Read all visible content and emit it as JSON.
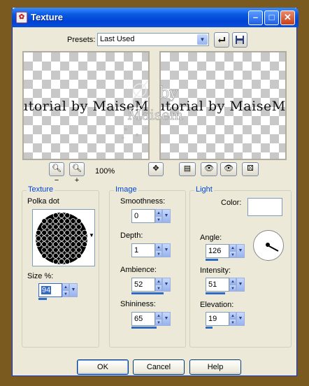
{
  "window": {
    "title": "Texture"
  },
  "presets": {
    "label": "Presets:",
    "value": "Last Used"
  },
  "preview": {
    "left_text": "utorial by MaiseMin",
    "right_text": "utorial by MaiseMin",
    "zoom": "100%"
  },
  "texture": {
    "group_title": "Texture",
    "name": "Polka dot",
    "size_label": "Size %:",
    "size_value": "94"
  },
  "image": {
    "group_title": "Image",
    "smoothness_label": "Smoothness:",
    "smoothness_value": "0",
    "depth_label": "Depth:",
    "depth_value": "1",
    "ambience_label": "Ambience:",
    "ambience_value": "52",
    "shininess_label": "Shininess:",
    "shininess_value": "65"
  },
  "light": {
    "group_title": "Light",
    "color_label": "Color:",
    "color_value": "#ffffff",
    "angle_label": "Angle:",
    "angle_value": "126",
    "intensity_label": "Intensity:",
    "intensity_value": "51",
    "elevation_label": "Elevation:",
    "elevation_value": "19"
  },
  "buttons": {
    "ok": "OK",
    "cancel": "Cancel",
    "help": "Help"
  },
  "icons": [
    "app-icon",
    "minimize-icon",
    "maximize-icon",
    "close-icon",
    "reset-icon",
    "save-icon",
    "zoom-out-icon",
    "zoom-in-icon",
    "pan-icon",
    "preview-toggle-icon",
    "eye-proof-icon",
    "eye-icon",
    "randomize-icon",
    "light-direction-icon"
  ]
}
